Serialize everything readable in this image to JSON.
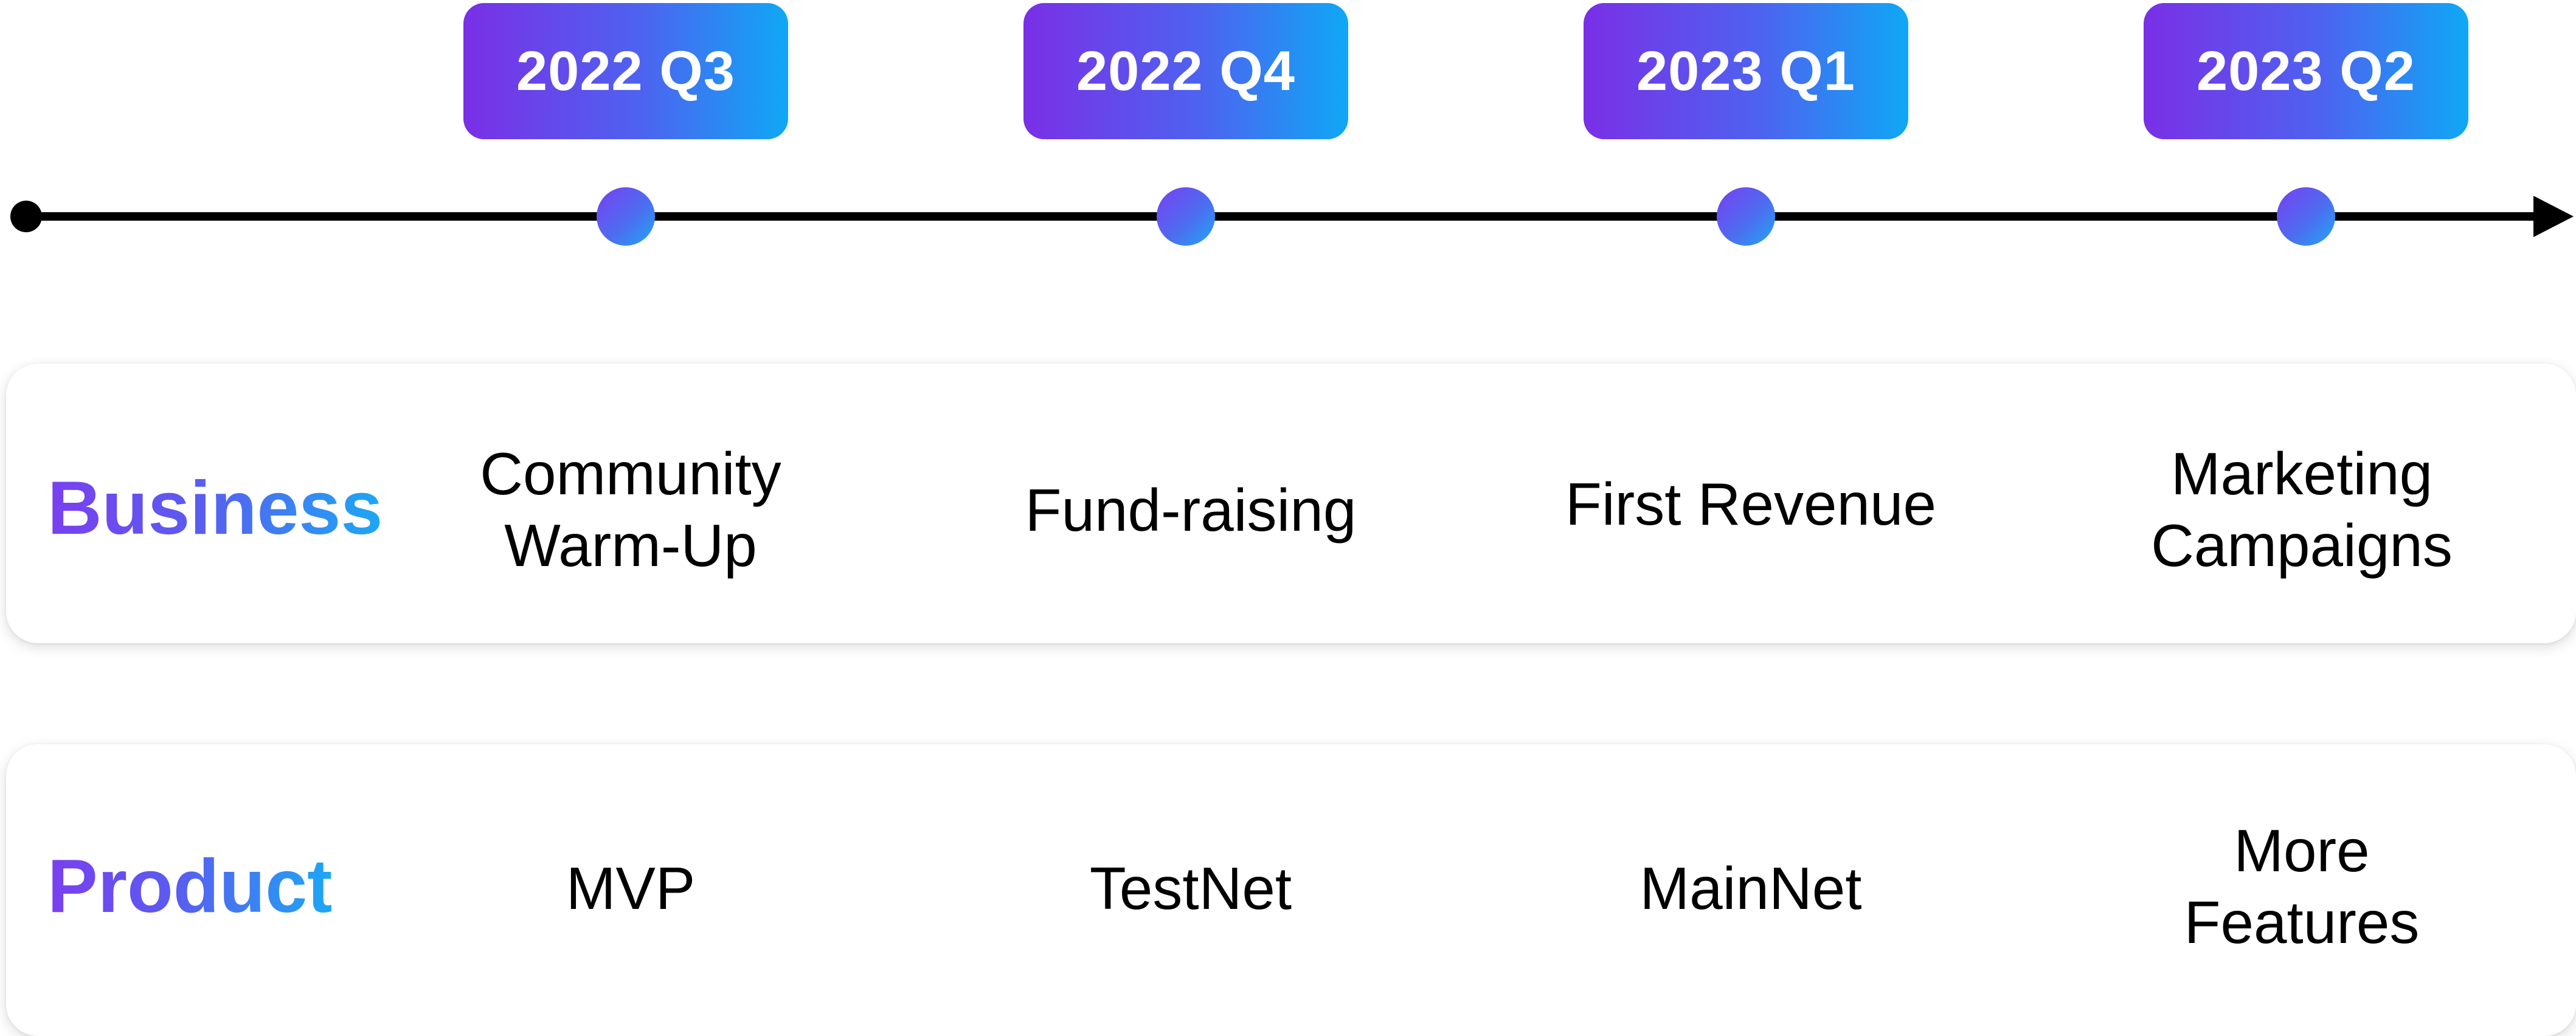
{
  "quarters": [
    "2022 Q3",
    "2022 Q4",
    "2023 Q1",
    "2023 Q2"
  ],
  "rows": {
    "business": {
      "label": "Business",
      "cells": [
        "Community\nWarm-Up",
        "Fund-raising",
        "First Revenue",
        "Marketing\nCampaigns"
      ]
    },
    "product": {
      "label": "Product",
      "cells": [
        "MVP",
        "TestNet",
        "MainNet",
        "More\nFeatures"
      ]
    }
  },
  "colors": {
    "gradient_start": "#7a2fe6",
    "gradient_mid": "#4d63f0",
    "gradient_end": "#0fa8f5",
    "line": "#000000",
    "text": "#000000",
    "card_background": "#ffffff"
  }
}
